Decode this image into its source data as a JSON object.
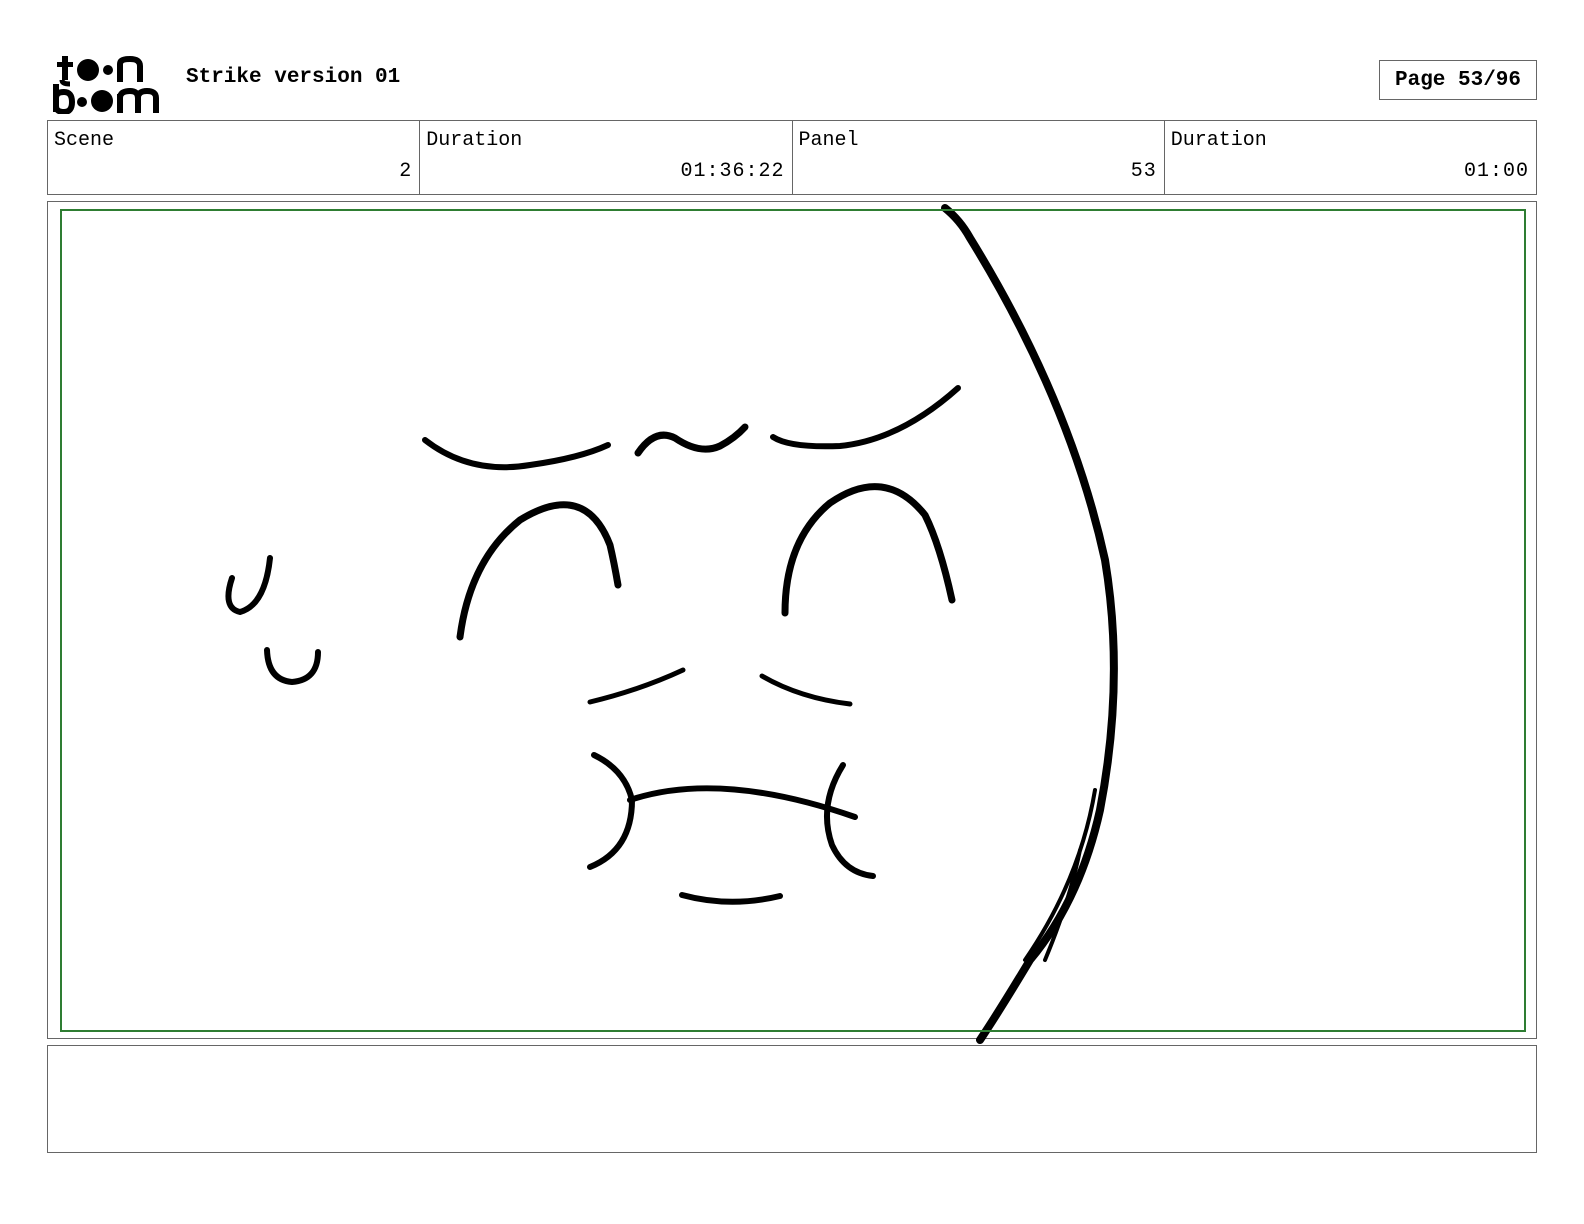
{
  "header": {
    "logo_alt": "toon boom",
    "title": "Strike version 01",
    "page_label": "Page 53/96"
  },
  "info": {
    "scene_label": "Scene",
    "scene_value": "2",
    "scene_duration_label": "Duration",
    "scene_duration_value": "01:36:22",
    "panel_label": "Panel",
    "panel_value": "53",
    "panel_duration_label": "Duration",
    "panel_duration_value": "01:00"
  },
  "panel": {
    "safe_frame_color": "#2e7d32",
    "drawing": "sketch-close-up-face"
  },
  "notes": {
    "text": ""
  }
}
